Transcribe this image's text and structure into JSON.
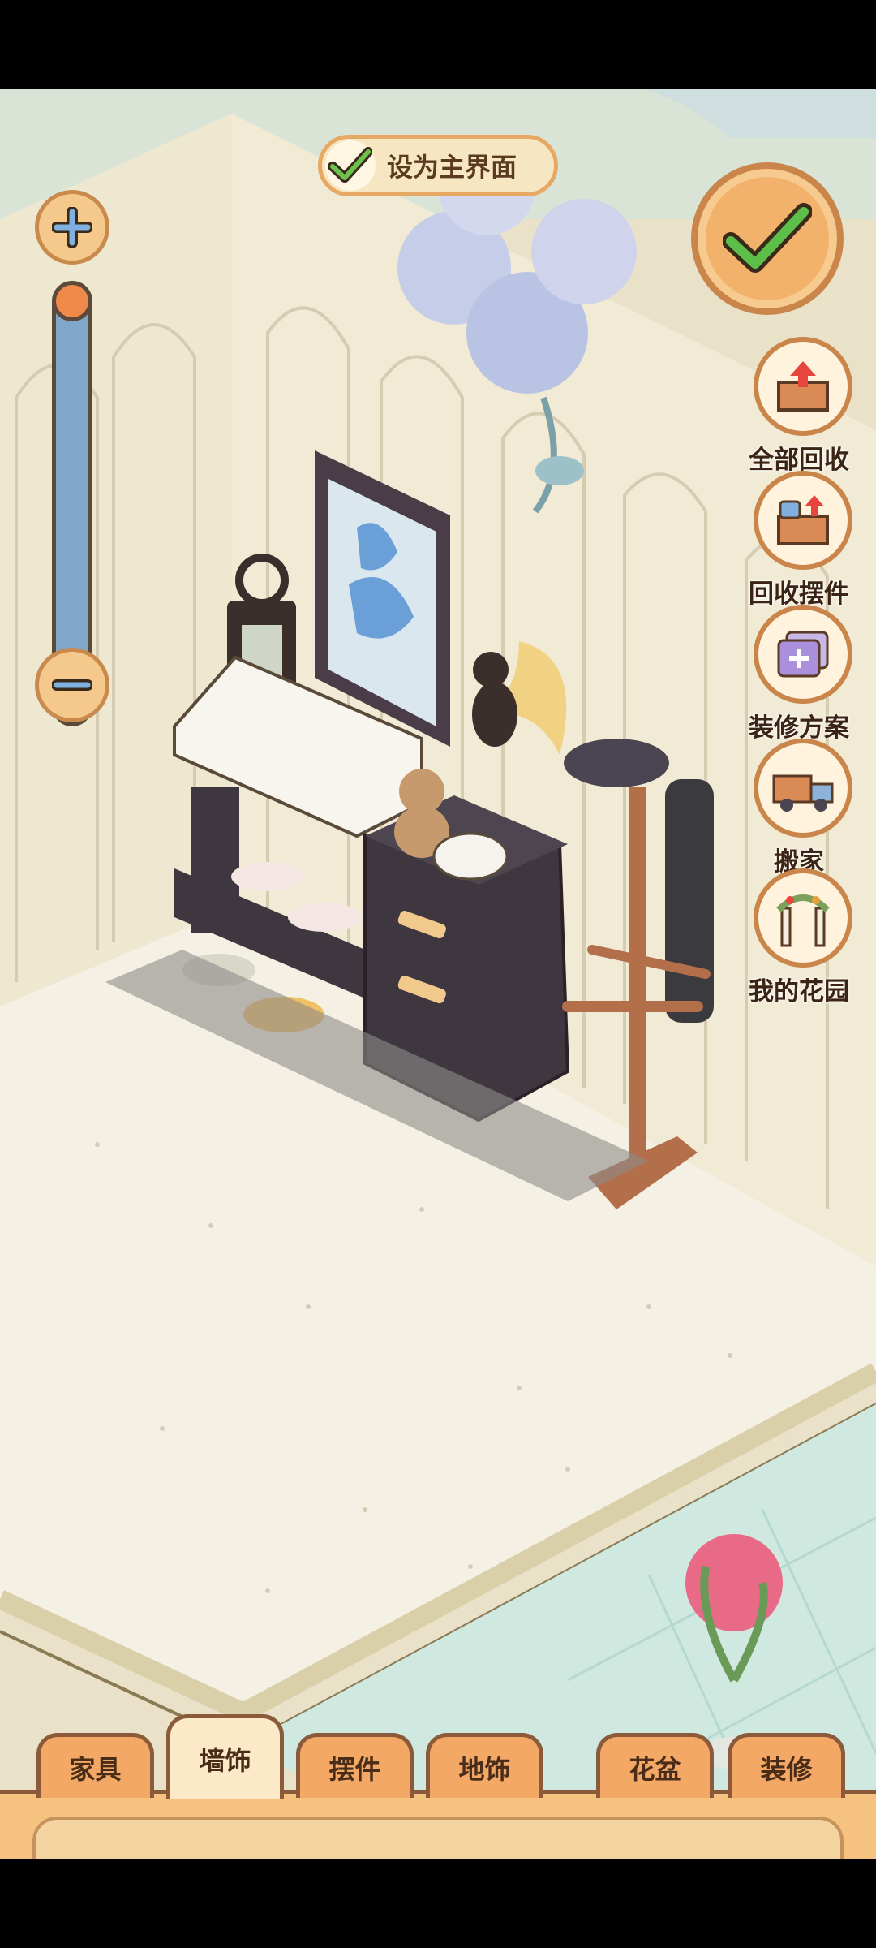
{
  "header": {
    "set_main_label": "设为主界面"
  },
  "zoom": {
    "plus_icon": "plus-icon",
    "minus_icon": "minus-icon",
    "level": 0.0
  },
  "confirm": {
    "icon": "checkmark-icon"
  },
  "side_menu": [
    {
      "label": "全部回收",
      "icon": "recycle-all-icon"
    },
    {
      "label": "回收摆件",
      "icon": "recycle-ornament-icon"
    },
    {
      "label": "装修方案",
      "icon": "decor-plan-icon"
    },
    {
      "label": "搬家",
      "icon": "moving-truck-icon"
    },
    {
      "label": "我的花园",
      "icon": "garden-arch-icon"
    }
  ],
  "tabs": [
    {
      "label": "家具"
    },
    {
      "label": "墙饰"
    },
    {
      "label": "摆件"
    },
    {
      "label": "地饰"
    },
    {
      "label": "花盆"
    },
    {
      "label": "装修"
    }
  ],
  "active_tab": "墙饰",
  "colors": {
    "accent": "#f2b26b",
    "check_green": "#5cbf4a",
    "wall": "#f1ead2",
    "floor": "#f4eee0"
  }
}
